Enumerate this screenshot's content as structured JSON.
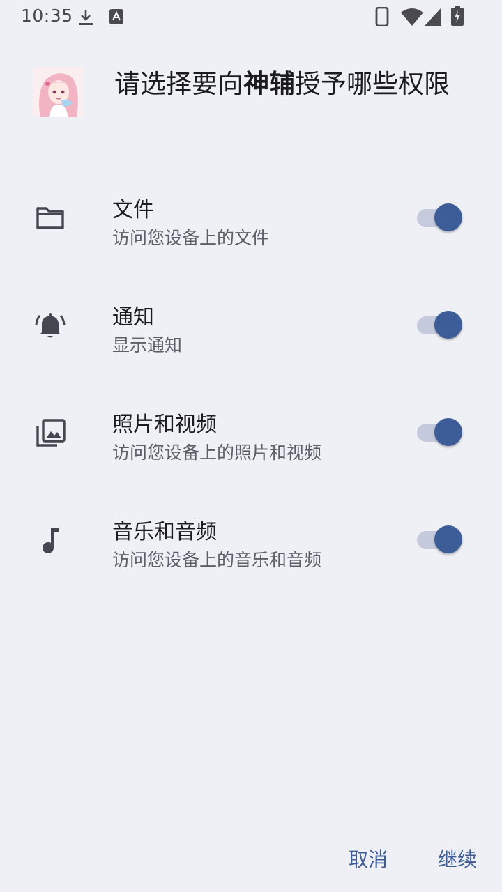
{
  "status_bar": {
    "time": "10:35",
    "icons": [
      "download-icon",
      "font-icon",
      "phone-icon",
      "wifi-icon",
      "signal-icon",
      "battery-charging-icon"
    ]
  },
  "dialog": {
    "title_prefix": "请选择要向",
    "app_name": "神辅",
    "title_suffix": "授予哪些权限",
    "avatar_icon": "app-avatar-anime-girl"
  },
  "permissions": [
    {
      "icon": "folder-icon",
      "title": "文件",
      "description": "访问您设备上的文件",
      "enabled": true
    },
    {
      "icon": "bell-ringing-icon",
      "title": "通知",
      "description": "显示通知",
      "enabled": true
    },
    {
      "icon": "photo-library-icon",
      "title": "照片和视频",
      "description": "访问您设备上的照片和视频",
      "enabled": true
    },
    {
      "icon": "music-note-icon",
      "title": "音乐和音频",
      "description": "访问您设备上的音乐和音频",
      "enabled": true
    }
  ],
  "buttons": {
    "cancel": "取消",
    "continue": "继续"
  },
  "colors": {
    "background": "#eff0f6",
    "accent": "#3d5d99",
    "toggle_track": "#c5cbdc",
    "icon": "#45464f"
  }
}
